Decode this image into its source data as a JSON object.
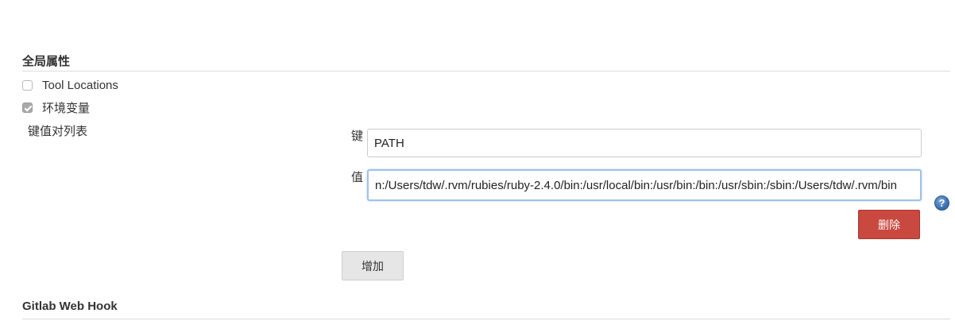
{
  "global_properties": {
    "title": "全局属性",
    "options": [
      {
        "label": "Tool Locations",
        "checked": false
      },
      {
        "label": "环境变量",
        "checked": true
      }
    ],
    "env_vars": {
      "list_label": "键值对列表",
      "key_label": "键",
      "key_value": "PATH",
      "value_label": "值",
      "value_value": "n:/Users/tdw/.rvm/rubies/ruby-2.4.0/bin:/usr/local/bin:/usr/bin:/bin:/usr/sbin:/sbin:/Users/tdw/.rvm/bin",
      "help_glyph": "?",
      "delete_label": "删除",
      "add_label": "增加"
    }
  },
  "gitlab_section": {
    "title": "Gitlab Web Hook"
  },
  "colors": {
    "delete_button": "#c9483f",
    "focus_border": "#9fc2ea",
    "help_icon": "#3c6fb3"
  }
}
